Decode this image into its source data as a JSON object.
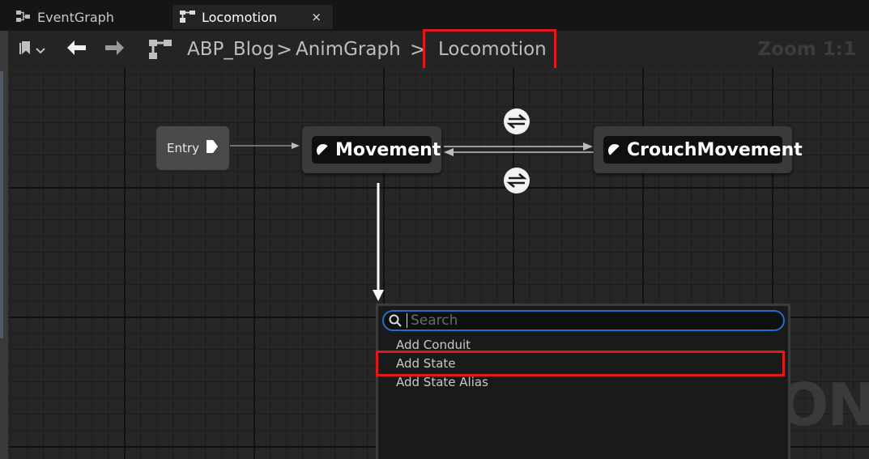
{
  "tabs": [
    {
      "label": "EventGraph",
      "icon": "event-graph-icon"
    },
    {
      "label": "Locomotion",
      "icon": "state-machine-icon",
      "close": "×"
    }
  ],
  "toolbar": {
    "breadcrumbs": [
      "ABP_Blog",
      "AnimGraph",
      "Locomotion"
    ],
    "separators": [
      ">",
      ">"
    ],
    "zoom": "Zoom 1:1"
  },
  "graph": {
    "entry_label": "Entry",
    "states": [
      "Movement",
      "CrouchMovement"
    ],
    "watermark": "ON"
  },
  "context_menu": {
    "search_placeholder": "Search",
    "items": [
      "Add Conduit",
      "Add State",
      "Add State Alias"
    ]
  },
  "colors": {
    "highlight": "#e0191c",
    "search_focus": "#1d6fc1"
  }
}
